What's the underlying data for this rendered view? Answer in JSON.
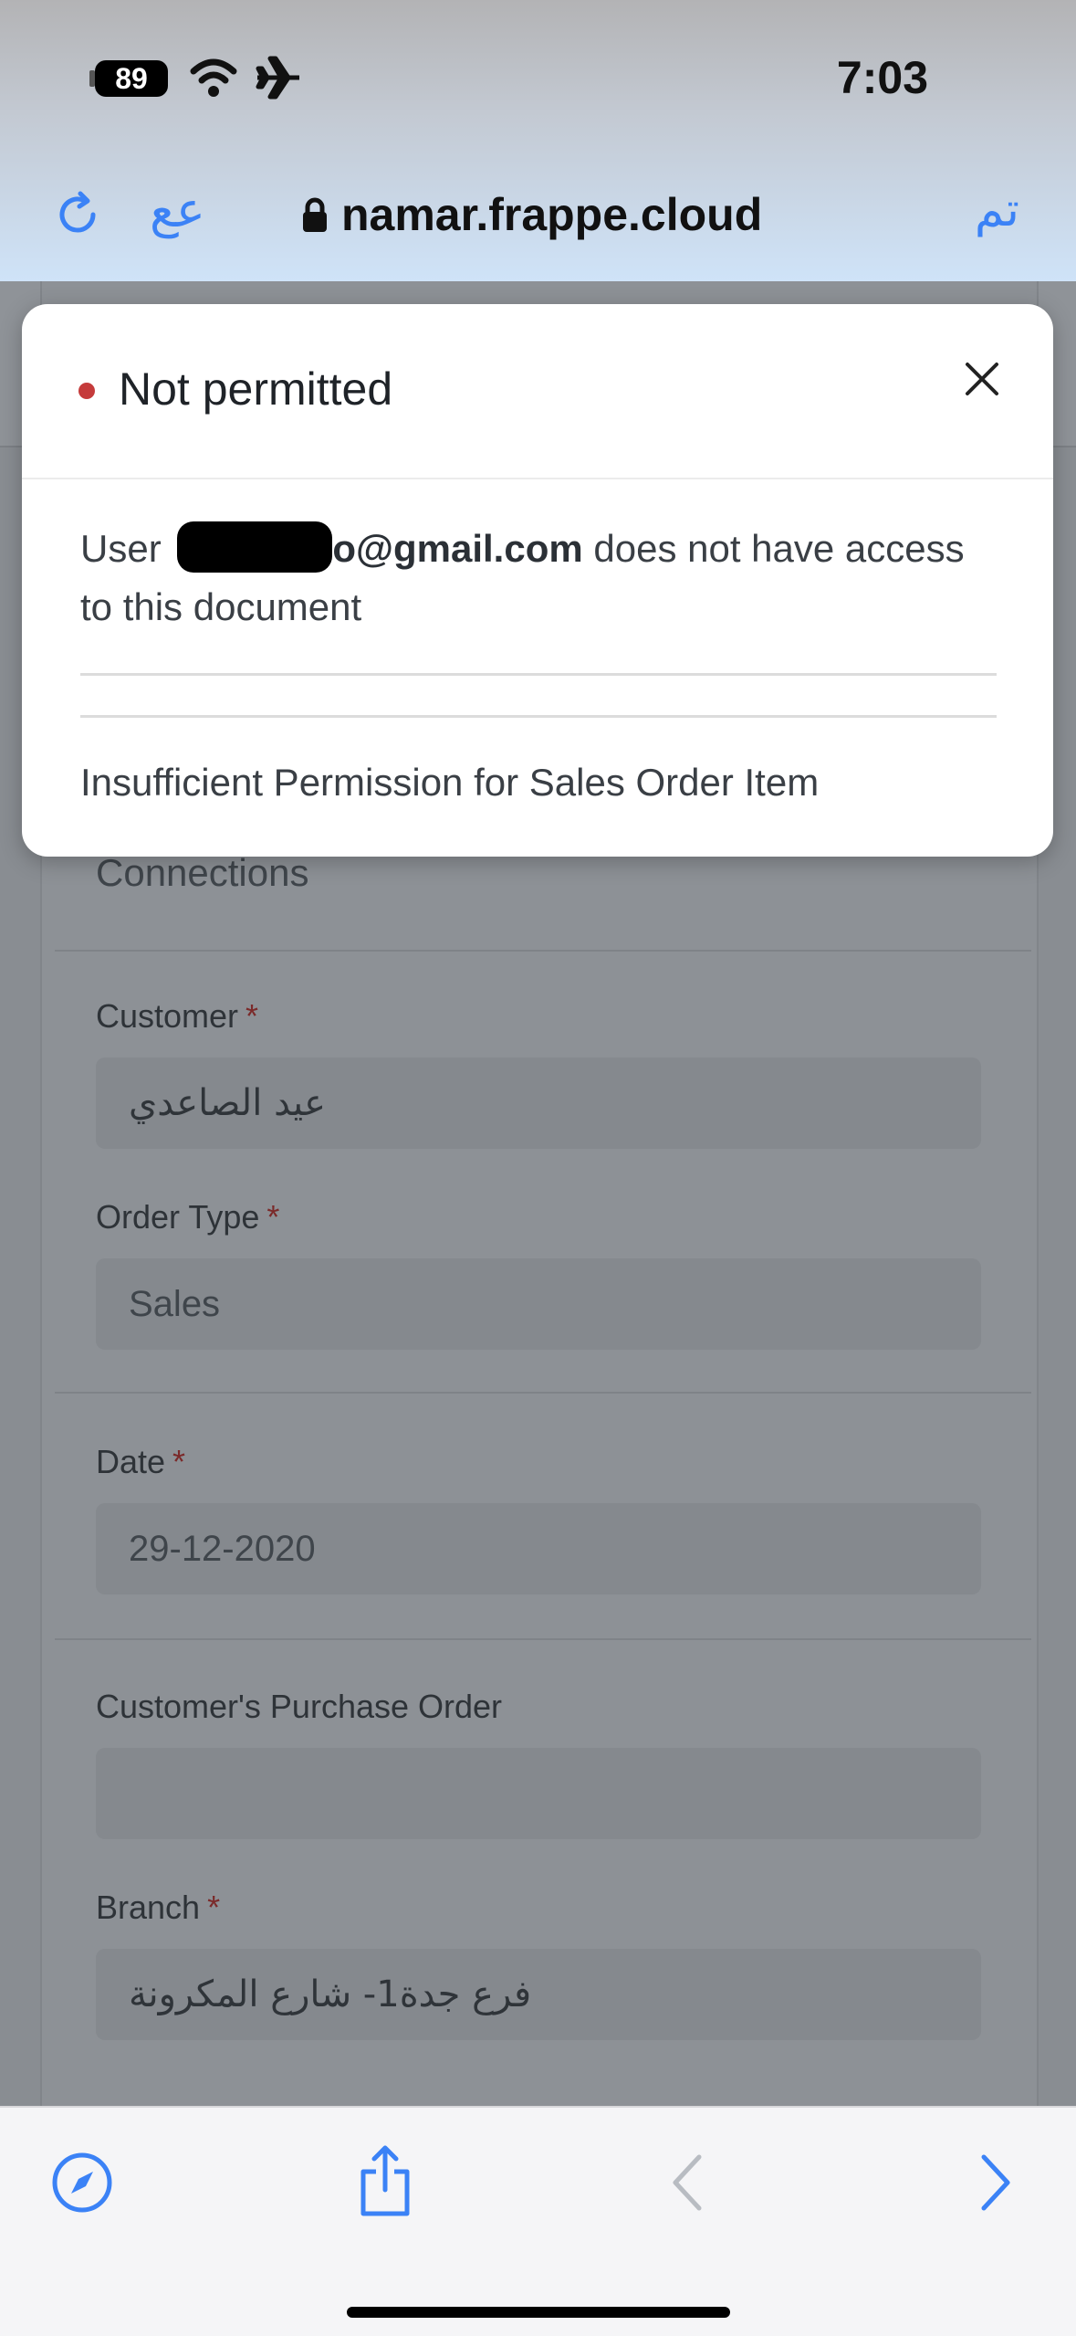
{
  "status_bar": {
    "time": "7:03",
    "battery": "89"
  },
  "browser": {
    "url": "namar.frappe.cloud",
    "translate_label": "عع",
    "done_label": "تم"
  },
  "form": {
    "connections_label": "Connections",
    "fields": [
      {
        "label": "Customer",
        "required": "*",
        "value": "عيد الصاعدي"
      },
      {
        "label": "Order Type",
        "required": "*",
        "value": "Sales"
      },
      {
        "label": "Date",
        "required": "*",
        "value": "29-12-2020"
      },
      {
        "label": "Customer's Purchase Order",
        "value": ""
      },
      {
        "label": "Branch",
        "required": "*",
        "value": "فرع جدة1- شارع المكرونة"
      }
    ]
  },
  "modal": {
    "title": "Not permitted",
    "message_prefix": "User ",
    "message_email_visible": "o@gmail.com",
    "message_suffix": " does not have access to this document",
    "detail": "Insufficient Permission for Sales Order Item",
    "indicator_color": "#c53b3b"
  },
  "colors": {
    "accent": "#3b82f6"
  },
  "icons": [
    "reload-icon",
    "lock-icon",
    "close-icon",
    "compass-icon",
    "share-icon",
    "back-icon",
    "forward-icon",
    "wifi-icon",
    "airplane-icon"
  ]
}
